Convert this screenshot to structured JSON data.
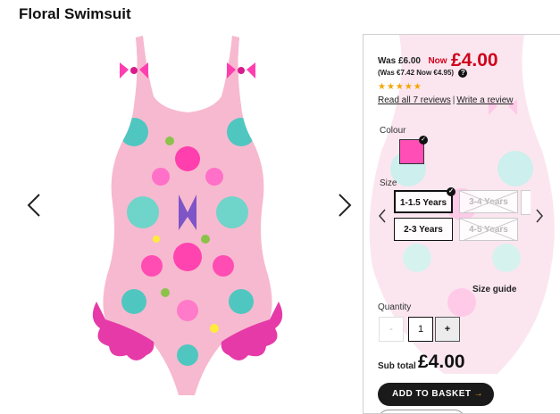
{
  "product": {
    "title": "Floral Swimsuit"
  },
  "gallery": {
    "prev_icon": "chevron-left-icon",
    "next_icon": "chevron-right-icon",
    "image": "floral-swimsuit-photo"
  },
  "pricing": {
    "was": "Was £6.00",
    "now_label": "Now",
    "now_price": "£4.00",
    "was_euro": "(Was €7.42 Now €4.95)",
    "help_icon": "question-icon",
    "help_text": "?",
    "accent_color": "#d0021b"
  },
  "reviews": {
    "stars": "★★★★★",
    "rating": 5,
    "read_all": "Read all 7 reviews",
    "separator": "|",
    "write": "Write a review",
    "star_color": "#f5a500"
  },
  "colour": {
    "label": "Colour",
    "selected_swatch": "#ff4fb6",
    "tick": "✓"
  },
  "size": {
    "label": "Size",
    "options": [
      {
        "label": "1-1.5 Years",
        "state": "selected"
      },
      {
        "label": "3-4 Years",
        "state": "unavailable"
      },
      {
        "label": "2-3 Years",
        "state": "available"
      },
      {
        "label": "4-5 Years",
        "state": "unavailable"
      }
    ],
    "guide": "Size guide"
  },
  "quantity": {
    "label": "Quantity",
    "minus": "-",
    "value": "1",
    "plus": "+"
  },
  "subtotal": {
    "label": "Sub total",
    "value": "£4.00"
  },
  "cart": {
    "add_label": "ADD TO BASKET",
    "arrow": "→"
  }
}
